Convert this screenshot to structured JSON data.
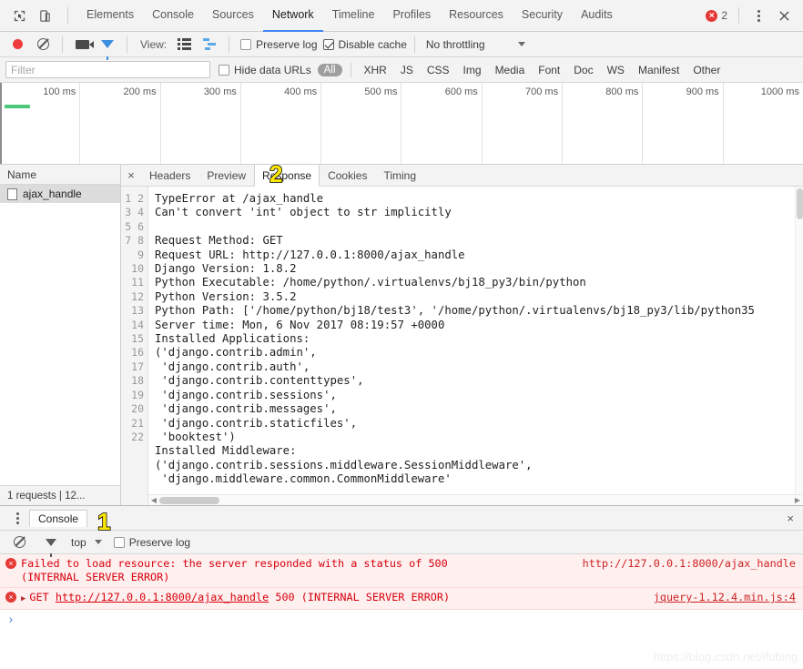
{
  "devtools": {
    "dock_icons": [
      "inspect-icon",
      "device-toggle-icon"
    ],
    "tabs": [
      {
        "label": "Elements",
        "active": false
      },
      {
        "label": "Console",
        "active": false
      },
      {
        "label": "Sources",
        "active": false
      },
      {
        "label": "Network",
        "active": true
      },
      {
        "label": "Timeline",
        "active": false
      },
      {
        "label": "Profiles",
        "active": false
      },
      {
        "label": "Resources",
        "active": false
      },
      {
        "label": "Security",
        "active": false
      },
      {
        "label": "Audits",
        "active": false
      }
    ],
    "error_count": "2",
    "more_label": "⋮",
    "close_label": "×"
  },
  "network_toolbar": {
    "record_icon": "record-icon",
    "clear_icon": "clear-icon",
    "capture_screenshots_icon": "camera-icon",
    "filter_icon": "funnel-icon",
    "view_label": "View:",
    "list_view_icon": "list-view-icon",
    "waterfall_view_icon": "waterfall-view-icon",
    "preserve_log_label": "Preserve log",
    "preserve_log_checked": false,
    "disable_cache_label": "Disable cache",
    "disable_cache_checked": true,
    "throttling_label": "No throttling"
  },
  "filter_bar": {
    "placeholder": "Filter",
    "value": "",
    "hide_data_urls_label": "Hide data URLs",
    "hide_data_urls_checked": false,
    "all_label": "All",
    "types": [
      "XHR",
      "JS",
      "CSS",
      "Img",
      "Media",
      "Font",
      "Doc",
      "WS",
      "Manifest",
      "Other"
    ]
  },
  "overview": {
    "ticks": [
      "100 ms",
      "200 ms",
      "300 ms",
      "400 ms",
      "500 ms",
      "600 ms",
      "700 ms",
      "800 ms",
      "900 ms",
      "1000 ms"
    ],
    "bar_color": "#4cc97a"
  },
  "requests": {
    "column_header": "Name",
    "rows": [
      {
        "name": "ajax_handle",
        "selected": true
      }
    ],
    "status_text": "1 requests  |  12..."
  },
  "detail": {
    "close_label": "×",
    "tabs": [
      {
        "label": "Headers",
        "active": false
      },
      {
        "label": "Preview",
        "active": false
      },
      {
        "label": "Response",
        "active": true
      },
      {
        "label": "Cookies",
        "active": false
      },
      {
        "label": "Timing",
        "active": false
      }
    ],
    "line_numbers": "1\n2\n3\n4\n5\n6\n7\n8\n9\n10\n11\n12\n13\n14\n15\n16\n17\n18\n19\n20\n21\n22",
    "response_text": "TypeError at /ajax_handle\nCan't convert 'int' object to str implicitly\n\nRequest Method: GET\nRequest URL: http://127.0.0.1:8000/ajax_handle\nDjango Version: 1.8.2\nPython Executable: /home/python/.virtualenvs/bj18_py3/bin/python\nPython Version: 3.5.2\nPython Path: ['/home/python/bj18/test3', '/home/python/.virtualenvs/bj18_py3/lib/python35\nServer time: Mon, 6 Nov 2017 08:19:57 +0000\nInstalled Applications:\n('django.contrib.admin',\n 'django.contrib.auth',\n 'django.contrib.contenttypes',\n 'django.contrib.sessions',\n 'django.contrib.messages',\n 'django.contrib.staticfiles',\n 'booktest')\nInstalled Middleware:\n('django.contrib.sessions.middleware.SessionMiddleware',\n 'django.middleware.common.CommonMiddleware'"
  },
  "drawer": {
    "menu_icon": "⋮",
    "tab_label": "Console",
    "close_label": "×",
    "clear_icon": "clear-icon",
    "filter_icon": "funnel-icon",
    "context_label": "top",
    "preserve_log_label": "Preserve log",
    "preserve_log_checked": false,
    "messages": [
      {
        "icon": "error-icon",
        "text": "Failed to load resource: the server responded with a status of 500",
        "text2": "(INTERNAL SERVER ERROR)",
        "source": "http://127.0.0.1:8000/ajax_handle",
        "expandable": false
      },
      {
        "icon": "error-icon",
        "method": "GET",
        "url": "http://127.0.0.1:8000/ajax_handle",
        "status": "500",
        "status_text": "(INTERNAL SERVER ERROR)",
        "source": "jquery-1.12.4.min.js:4",
        "expandable": true
      }
    ],
    "prompt_symbol": "›"
  },
  "annotations": [
    {
      "label": "2",
      "target": "response-tab"
    },
    {
      "label": "1",
      "target": "console-tab"
    }
  ],
  "watermark": "https://blog.csdn.net/ifubing"
}
